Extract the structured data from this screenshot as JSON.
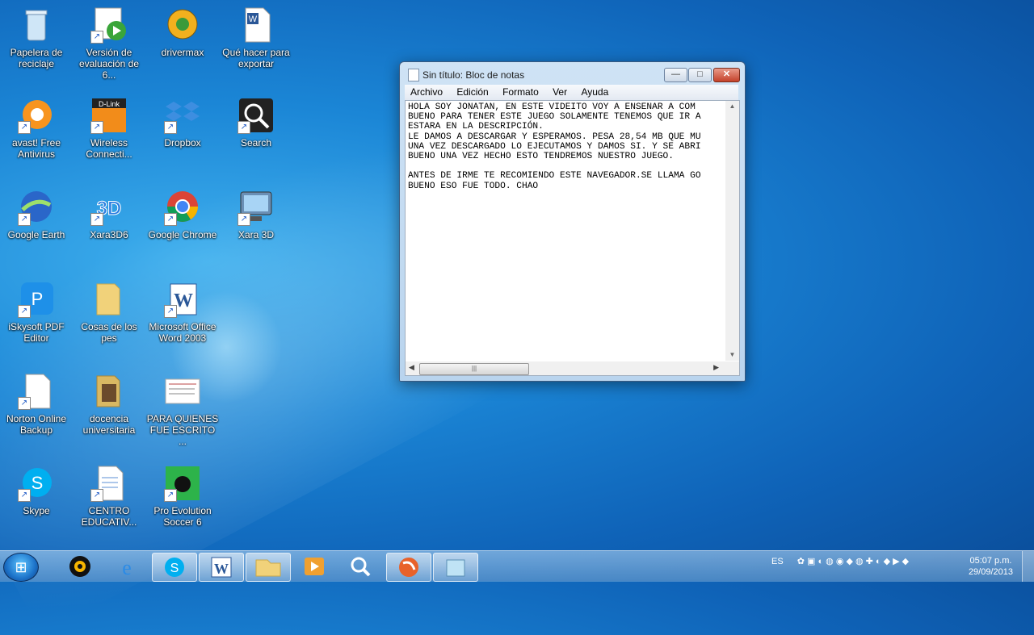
{
  "desktop": {
    "icons": [
      {
        "label": "Papelera de reciclaje",
        "glyph": "🗑"
      },
      {
        "label": "Versión de evaluación de 6...",
        "glyph": "▶"
      },
      {
        "label": "drivermax",
        "glyph": "⚙"
      },
      {
        "label": "Qué hacer para exportar",
        "glyph": "W"
      },
      {
        "label": "avast! Free Antivirus",
        "glyph": "a"
      },
      {
        "label": "Wireless Connecti...",
        "glyph": "D-Link"
      },
      {
        "label": "Dropbox",
        "glyph": "◆"
      },
      {
        "label": "Search",
        "glyph": "🔍"
      },
      {
        "label": "Google Earth",
        "glyph": "🌍"
      },
      {
        "label": "Xara3D6",
        "glyph": "3D"
      },
      {
        "label": "Google Chrome",
        "glyph": "◉"
      },
      {
        "label": "Xara 3D",
        "glyph": "▣"
      },
      {
        "label": "iSkysoft PDF Editor",
        "glyph": "P"
      },
      {
        "label": "Cosas de los pes",
        "glyph": "📁"
      },
      {
        "label": "Microsoft Office Word 2003",
        "glyph": "W"
      },
      {
        "label": "Norton Online Backup",
        "glyph": "📄"
      },
      {
        "label": "docencia universitaria",
        "glyph": "📁"
      },
      {
        "label": "PARA QUIENES FUE ESCRITO ...",
        "glyph": "📰"
      },
      {
        "label": "Skype",
        "glyph": "S"
      },
      {
        "label": "CENTRO EDUCATIV...",
        "glyph": "📄"
      },
      {
        "label": "Pro Evolution Soccer 6",
        "glyph": "⚽"
      }
    ]
  },
  "notepad": {
    "title": "Sin título: Bloc de notas",
    "buttons": {
      "minimize": "—",
      "maximize": "□",
      "close": "✕"
    },
    "menu": [
      "Archivo",
      "Edición",
      "Formato",
      "Ver",
      "Ayuda"
    ],
    "content": "HOLA SOY JONATAN, EN ESTE VIDEITO VOY A ENSEÑAR A COM\nBUENO PARA TENER ESTE JUEGO SOLAMENTE TENEMOS QUE IR A\nESTARA EN LA DESCRIPCIÓN.\nLE DAMOS A DESCARGAR Y ESPERAMOS. PESA 28,54 MB QUE MU\nUNA VEZ DESCARGADO LO EJECUTAMOS Y DAMOS SI. Y SE ABRI\nBUENO UNA VEZ HECHO ESTO TENDREMOS NUESTRO JUEGO.\n\nANTES DE IRME TE RECOMIENDO ESTE NAVEGADOR.SE LLAMA GO\nBUENO ESO FUE TODO. CHAO"
  },
  "taskbar": {
    "start": "⊞",
    "items": [
      {
        "name": "media-player",
        "glyph": "◎"
      },
      {
        "name": "internet-explorer",
        "glyph": "e"
      },
      {
        "name": "skype",
        "glyph": "S"
      },
      {
        "name": "word",
        "glyph": "W"
      },
      {
        "name": "explorer",
        "glyph": "📁"
      },
      {
        "name": "video-player",
        "glyph": "▶"
      },
      {
        "name": "search",
        "glyph": "🔍"
      },
      {
        "name": "recorder",
        "glyph": "◐"
      },
      {
        "name": "notepad",
        "glyph": "▭"
      }
    ],
    "language": "ES",
    "time": "05:07 p.m.",
    "date": "29/09/2013"
  }
}
